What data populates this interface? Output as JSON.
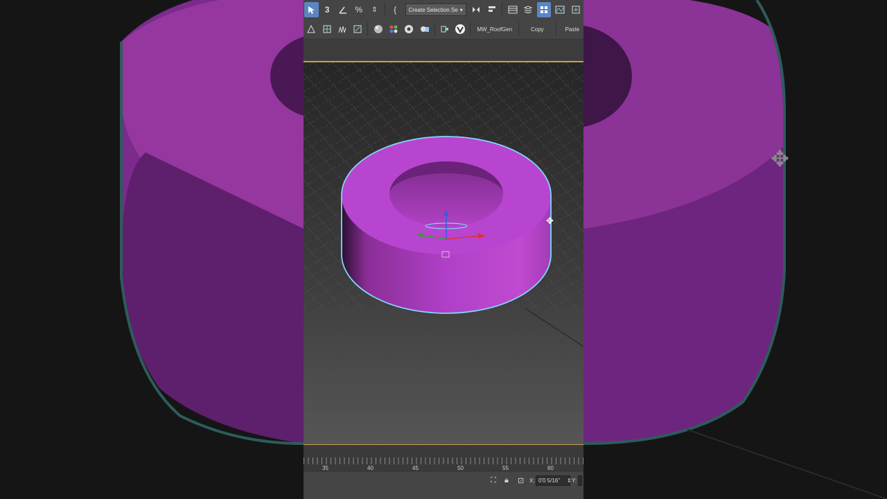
{
  "toolbar": {
    "selection_set_label": "Create Selection Se",
    "roofgen_label": "MW_RoofGen",
    "copy_label": "Copy",
    "paste_label": "Paste"
  },
  "timeline": {
    "ticks": [
      "35",
      "40",
      "45",
      "50",
      "55",
      "60"
    ]
  },
  "statusbar": {
    "x_label": "X:",
    "x_value": "0'0 5/16\"",
    "y_label": "Y:"
  },
  "colors": {
    "object": "#b040c8",
    "selection_outline": "#7fd6ff",
    "viewport_border": "#c8a04a"
  },
  "icons": [
    "select-icon",
    "snap-3d-icon",
    "angle-snap-icon",
    "percent-snap-icon",
    "spinner-snap-icon",
    "named-selection-icon",
    "mirror-icon",
    "align-icon",
    "scene-explorer-icon",
    "layer-explorer-icon",
    "ribbon-toggle-icon",
    "curve-editor-icon",
    "schematic-icon",
    "material-editor-icon",
    "render-setup-icon",
    "render-frame-icon",
    "render-icon",
    "vray-icon",
    "zoom-extents-icon",
    "lock-icon",
    "absolute-mode-icon",
    "move-cursor-icon"
  ]
}
